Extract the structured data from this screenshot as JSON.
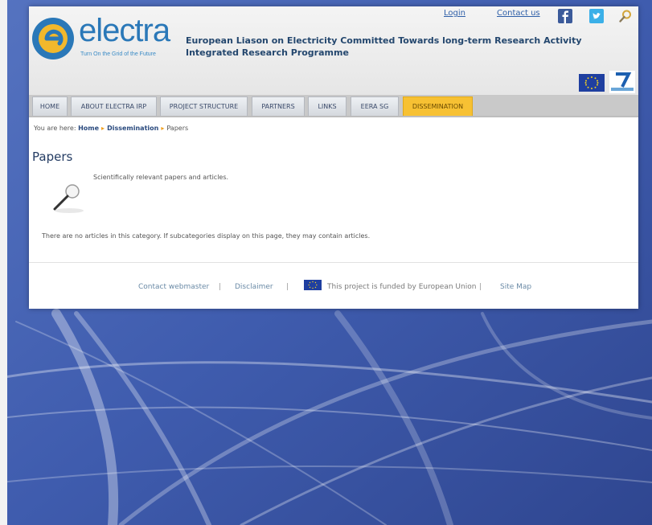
{
  "header": {
    "logo_text": "electra",
    "logo_tagline": "Turn On the Grid of the Future",
    "title_line1": "European Liason on Electricity Committed Towards long-term Research Activity",
    "title_line2": "Integrated Research Programme",
    "login_link": "Login",
    "contact_link": "Contact us"
  },
  "nav": {
    "tabs": [
      {
        "label": "HOME",
        "active": false
      },
      {
        "label": "ABOUT ELECTRA IRP",
        "active": false
      },
      {
        "label": "PROJECT STRUCTURE",
        "active": false
      },
      {
        "label": "PARTNERS",
        "active": false
      },
      {
        "label": "LINKS",
        "active": false
      },
      {
        "label": "EERA SG",
        "active": false
      },
      {
        "label": "DISSEMINATION",
        "active": true
      }
    ]
  },
  "breadcrumb": {
    "prefix": "You are here:",
    "items": [
      "Home",
      "Dissemination",
      "Papers"
    ]
  },
  "content": {
    "title": "Papers",
    "description": "Scientifically relevant papers and articles.",
    "notice": "There are no articles in this category. If subcategories display on this page, they may contain articles."
  },
  "footer": {
    "contact": "Contact webmaster",
    "disclaimer": "Disclaimer",
    "funded": "This project is funded by European Union",
    "sitemap": "Site Map",
    "separator": "|"
  },
  "colors": {
    "active_tab": "#f7c133",
    "brand_blue": "#2a78b8",
    "background": "#3d5aa8"
  },
  "icons": [
    "electra-logo",
    "facebook-icon",
    "twitter-icon",
    "search-icon",
    "eu-flag-icon",
    "fp7-logo",
    "magnifier-icon"
  ]
}
